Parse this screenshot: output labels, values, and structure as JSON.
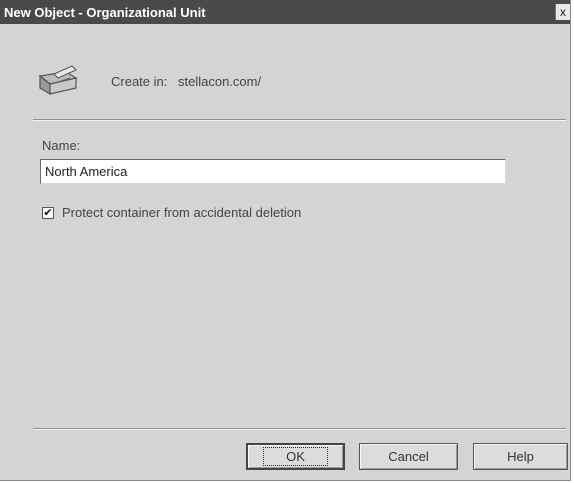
{
  "window": {
    "title": "New Object - Organizational Unit",
    "close_glyph": "x"
  },
  "header": {
    "icon": "folder-ou-icon",
    "create_in_label": "Create in:",
    "create_in_path": "stellacon.com/"
  },
  "form": {
    "name_label": "Name:",
    "name_value": "North America",
    "protect_checkbox": {
      "label": "Protect container from accidental deletion",
      "checked": true,
      "check_glyph": "✔"
    }
  },
  "buttons": {
    "ok": "OK",
    "cancel": "Cancel",
    "help": "Help"
  }
}
